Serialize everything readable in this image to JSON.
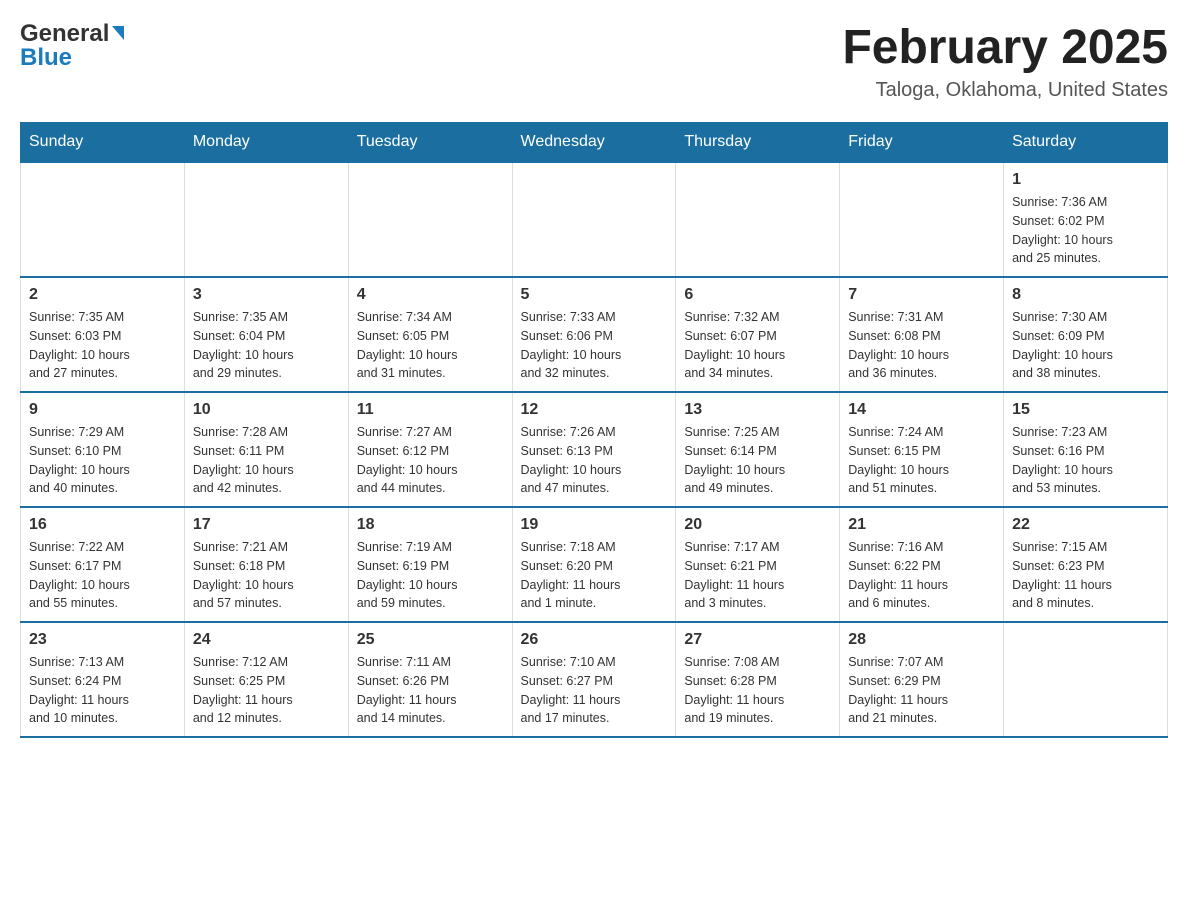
{
  "header": {
    "logo_general": "General",
    "logo_blue": "Blue",
    "title": "February 2025",
    "subtitle": "Taloga, Oklahoma, United States"
  },
  "weekdays": [
    "Sunday",
    "Monday",
    "Tuesday",
    "Wednesday",
    "Thursday",
    "Friday",
    "Saturday"
  ],
  "weeks": [
    [
      {
        "day": "",
        "info": ""
      },
      {
        "day": "",
        "info": ""
      },
      {
        "day": "",
        "info": ""
      },
      {
        "day": "",
        "info": ""
      },
      {
        "day": "",
        "info": ""
      },
      {
        "day": "",
        "info": ""
      },
      {
        "day": "1",
        "info": "Sunrise: 7:36 AM\nSunset: 6:02 PM\nDaylight: 10 hours\nand 25 minutes."
      }
    ],
    [
      {
        "day": "2",
        "info": "Sunrise: 7:35 AM\nSunset: 6:03 PM\nDaylight: 10 hours\nand 27 minutes."
      },
      {
        "day": "3",
        "info": "Sunrise: 7:35 AM\nSunset: 6:04 PM\nDaylight: 10 hours\nand 29 minutes."
      },
      {
        "day": "4",
        "info": "Sunrise: 7:34 AM\nSunset: 6:05 PM\nDaylight: 10 hours\nand 31 minutes."
      },
      {
        "day": "5",
        "info": "Sunrise: 7:33 AM\nSunset: 6:06 PM\nDaylight: 10 hours\nand 32 minutes."
      },
      {
        "day": "6",
        "info": "Sunrise: 7:32 AM\nSunset: 6:07 PM\nDaylight: 10 hours\nand 34 minutes."
      },
      {
        "day": "7",
        "info": "Sunrise: 7:31 AM\nSunset: 6:08 PM\nDaylight: 10 hours\nand 36 minutes."
      },
      {
        "day": "8",
        "info": "Sunrise: 7:30 AM\nSunset: 6:09 PM\nDaylight: 10 hours\nand 38 minutes."
      }
    ],
    [
      {
        "day": "9",
        "info": "Sunrise: 7:29 AM\nSunset: 6:10 PM\nDaylight: 10 hours\nand 40 minutes."
      },
      {
        "day": "10",
        "info": "Sunrise: 7:28 AM\nSunset: 6:11 PM\nDaylight: 10 hours\nand 42 minutes."
      },
      {
        "day": "11",
        "info": "Sunrise: 7:27 AM\nSunset: 6:12 PM\nDaylight: 10 hours\nand 44 minutes."
      },
      {
        "day": "12",
        "info": "Sunrise: 7:26 AM\nSunset: 6:13 PM\nDaylight: 10 hours\nand 47 minutes."
      },
      {
        "day": "13",
        "info": "Sunrise: 7:25 AM\nSunset: 6:14 PM\nDaylight: 10 hours\nand 49 minutes."
      },
      {
        "day": "14",
        "info": "Sunrise: 7:24 AM\nSunset: 6:15 PM\nDaylight: 10 hours\nand 51 minutes."
      },
      {
        "day": "15",
        "info": "Sunrise: 7:23 AM\nSunset: 6:16 PM\nDaylight: 10 hours\nand 53 minutes."
      }
    ],
    [
      {
        "day": "16",
        "info": "Sunrise: 7:22 AM\nSunset: 6:17 PM\nDaylight: 10 hours\nand 55 minutes."
      },
      {
        "day": "17",
        "info": "Sunrise: 7:21 AM\nSunset: 6:18 PM\nDaylight: 10 hours\nand 57 minutes."
      },
      {
        "day": "18",
        "info": "Sunrise: 7:19 AM\nSunset: 6:19 PM\nDaylight: 10 hours\nand 59 minutes."
      },
      {
        "day": "19",
        "info": "Sunrise: 7:18 AM\nSunset: 6:20 PM\nDaylight: 11 hours\nand 1 minute."
      },
      {
        "day": "20",
        "info": "Sunrise: 7:17 AM\nSunset: 6:21 PM\nDaylight: 11 hours\nand 3 minutes."
      },
      {
        "day": "21",
        "info": "Sunrise: 7:16 AM\nSunset: 6:22 PM\nDaylight: 11 hours\nand 6 minutes."
      },
      {
        "day": "22",
        "info": "Sunrise: 7:15 AM\nSunset: 6:23 PM\nDaylight: 11 hours\nand 8 minutes."
      }
    ],
    [
      {
        "day": "23",
        "info": "Sunrise: 7:13 AM\nSunset: 6:24 PM\nDaylight: 11 hours\nand 10 minutes."
      },
      {
        "day": "24",
        "info": "Sunrise: 7:12 AM\nSunset: 6:25 PM\nDaylight: 11 hours\nand 12 minutes."
      },
      {
        "day": "25",
        "info": "Sunrise: 7:11 AM\nSunset: 6:26 PM\nDaylight: 11 hours\nand 14 minutes."
      },
      {
        "day": "26",
        "info": "Sunrise: 7:10 AM\nSunset: 6:27 PM\nDaylight: 11 hours\nand 17 minutes."
      },
      {
        "day": "27",
        "info": "Sunrise: 7:08 AM\nSunset: 6:28 PM\nDaylight: 11 hours\nand 19 minutes."
      },
      {
        "day": "28",
        "info": "Sunrise: 7:07 AM\nSunset: 6:29 PM\nDaylight: 11 hours\nand 21 minutes."
      },
      {
        "day": "",
        "info": ""
      }
    ]
  ]
}
